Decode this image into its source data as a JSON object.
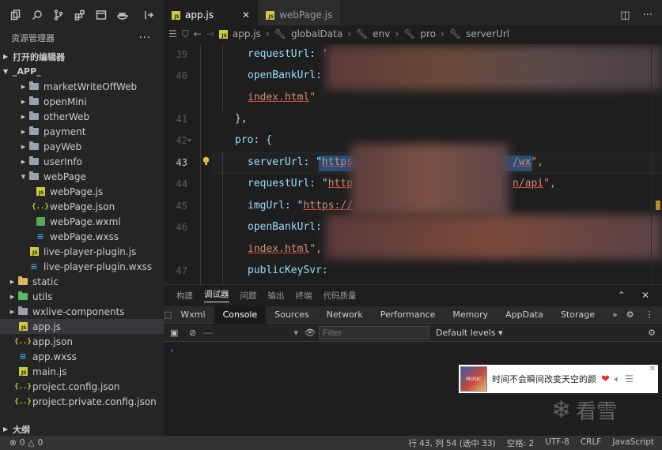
{
  "sidebar": {
    "activity_icons": [
      "copy-icon",
      "search-icon",
      "source-control-icon",
      "extensions-icon",
      "remote-icon",
      "docker-icon",
      "split-icon"
    ],
    "explorer_title": "资源管理器",
    "more": "···",
    "open_editors": "打开的编辑器",
    "root": "_APP_",
    "tree": [
      {
        "label": "marketWriteOffWeb",
        "kind": "folder",
        "depth": 1
      },
      {
        "label": "openMini",
        "kind": "folder",
        "depth": 1
      },
      {
        "label": "otherWeb",
        "kind": "folder",
        "depth": 1
      },
      {
        "label": "payment",
        "kind": "folder",
        "depth": 1
      },
      {
        "label": "payWeb",
        "kind": "folder",
        "depth": 1
      },
      {
        "label": "userInfo",
        "kind": "folder",
        "depth": 1
      },
      {
        "label": "webPage",
        "kind": "folder-open",
        "depth": 1
      },
      {
        "label": "webPage.js",
        "kind": "js",
        "depth": 2
      },
      {
        "label": "webPage.json",
        "kind": "json",
        "depth": 2
      },
      {
        "label": "webPage.wxml",
        "kind": "wxml",
        "depth": 2
      },
      {
        "label": "webPage.wxss",
        "kind": "wxss",
        "depth": 2
      },
      {
        "label": "live-player-plugin.js",
        "kind": "js",
        "depth": 1
      },
      {
        "label": "live-player-plugin.wxss",
        "kind": "wxss",
        "depth": 1
      },
      {
        "label": "static",
        "kind": "folder-yellow",
        "depth": 0
      },
      {
        "label": "utils",
        "kind": "folder-green",
        "depth": 0
      },
      {
        "label": "wxlive-components",
        "kind": "folder",
        "depth": 0
      },
      {
        "label": "app.js",
        "kind": "js",
        "depth": 0,
        "active": true
      },
      {
        "label": "app.json",
        "kind": "json",
        "depth": 0
      },
      {
        "label": "app.wxss",
        "kind": "wxss",
        "depth": 0
      },
      {
        "label": "main.js",
        "kind": "js",
        "depth": 0
      },
      {
        "label": "project.config.json",
        "kind": "json",
        "depth": 0
      },
      {
        "label": "project.private.config.json",
        "kind": "json",
        "depth": 0
      }
    ],
    "outline": "大纲"
  },
  "tabs": [
    {
      "label": "app.js",
      "active": true,
      "close": "✕"
    },
    {
      "label": "webPage.js",
      "active": false
    }
  ],
  "breadcrumbs": [
    "app.js",
    "globalData",
    "env",
    "pro",
    "serverUrl"
  ],
  "code": {
    "line_numbers": [
      "39",
      "40",
      "",
      "41",
      "42",
      "43",
      "44",
      "45",
      "46",
      "",
      "47"
    ],
    "current_line": "43",
    "lines": {
      "l39": "requestUrl: '",
      "l40": "openBankUrl:",
      "l40b_url": "index.html",
      "l40b_tail": "\"",
      "l41": "},",
      "l42": "pro: {",
      "l43_key": "serverUrl: \"",
      "l43_url_a": "https",
      "l43_url_b": "/wx",
      "l43_tail": "\",",
      "l44_key": "requestUrl: \"",
      "l44_url_a": "http",
      "l44_url_b": "n/api",
      "l44_tail": "\",",
      "l45_key": "imgUrl: \"",
      "l45_url": "https://",
      "l46": "openBankUrl:",
      "l46b_url": "index.html",
      "l46b_tail": "\",",
      "l47": "publicKeySvr:"
    }
  },
  "panel": {
    "tabs": [
      "构建",
      "调试器",
      "问题",
      "输出",
      "终端",
      "代码质量"
    ],
    "active_tab": "调试器",
    "devtools_tabs": [
      "Wxml",
      "Console",
      "Sources",
      "Network",
      "Performance",
      "Memory",
      "AppData",
      "Storage"
    ],
    "devtools_more": "»",
    "active_devtools_tab": "Console",
    "context": "---",
    "filter_placeholder": "Filter",
    "levels": "Default levels ▾",
    "prompt": "›"
  },
  "music_popup": {
    "title": "时间不会瞬间改变天空的颜",
    "cover_text": "MUSIC"
  },
  "watermark": "看雪",
  "statusbar": {
    "errors": "0",
    "warnings": "0",
    "position": "行 43, 列 54 (选中 33)",
    "spaces": "空格: 2",
    "encoding": "UTF-8",
    "eol": "CRLF",
    "language": "JavaScript"
  }
}
